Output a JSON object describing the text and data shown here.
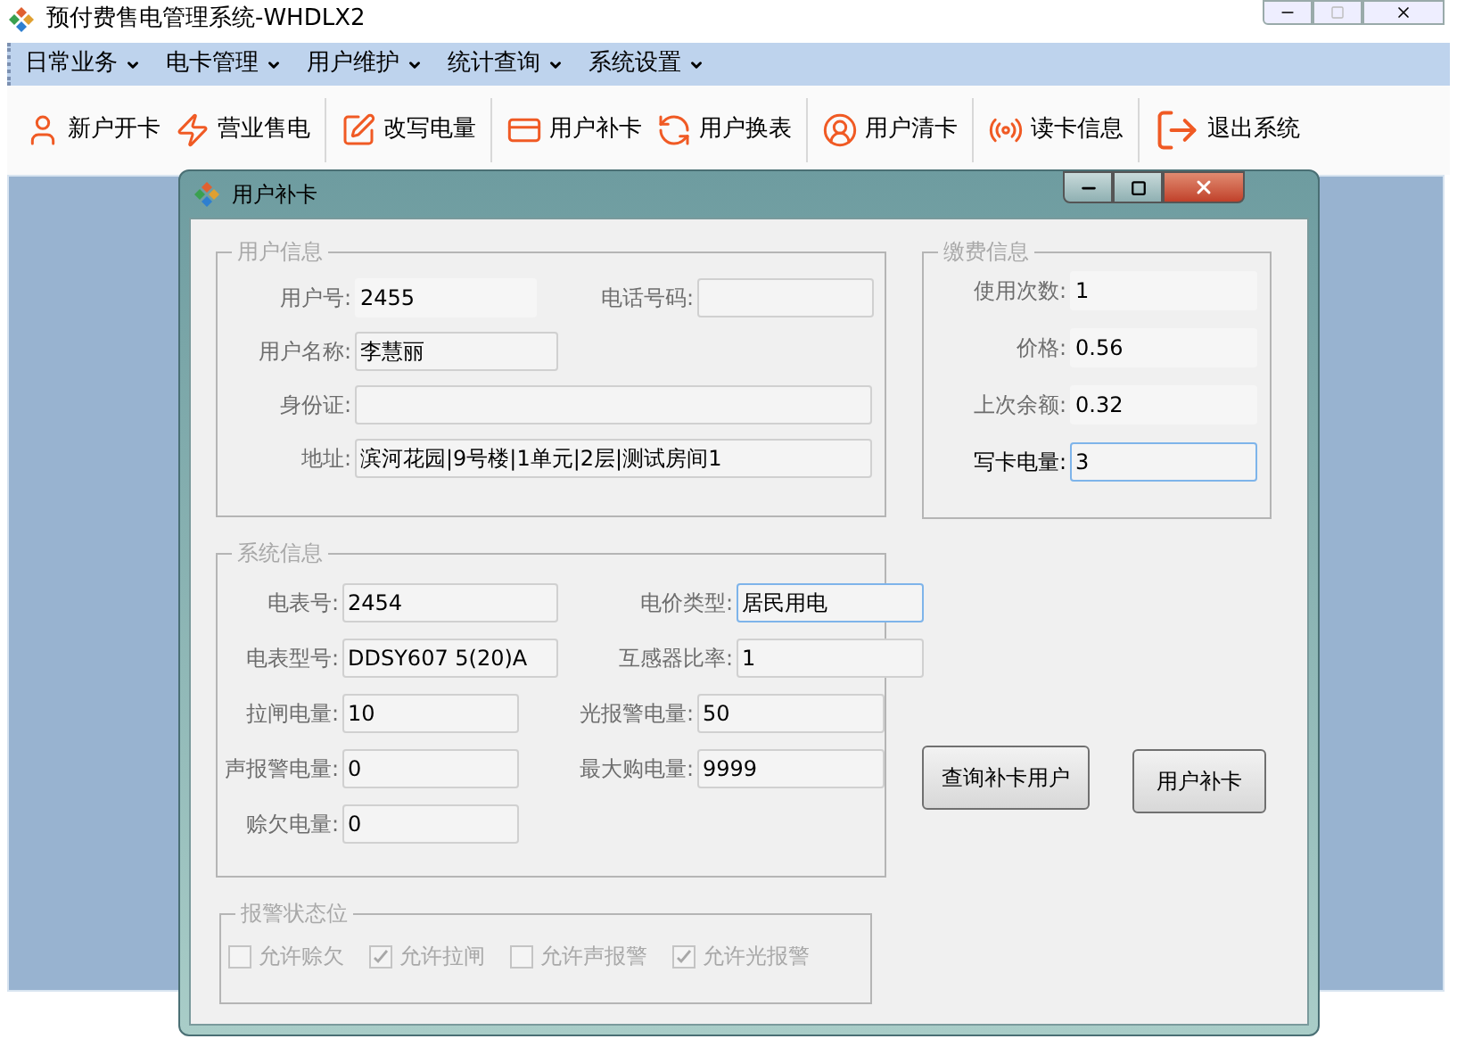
{
  "window": {
    "title": "预付费售电管理系统-WHDLX2"
  },
  "menu": [
    {
      "label": "日常业务"
    },
    {
      "label": "电卡管理"
    },
    {
      "label": "用户维护"
    },
    {
      "label": "统计查询"
    },
    {
      "label": "系统设置"
    }
  ],
  "toolbar": [
    [
      {
        "label": "新户开卡"
      },
      {
        "label": "营业售电"
      }
    ],
    [
      {
        "label": "改写电量"
      }
    ],
    [
      {
        "label": "用户补卡"
      },
      {
        "label": "用户换表"
      }
    ],
    [
      {
        "label": "用户清卡"
      }
    ],
    [
      {
        "label": "读卡信息"
      }
    ],
    [
      {
        "label": "退出系统"
      }
    ]
  ],
  "dialog": {
    "title": "用户补卡",
    "user_info": {
      "title": "用户信息",
      "fields": [
        {
          "label": "用户号:",
          "value": "2455",
          "kind": "flat",
          "disabled": true
        },
        {
          "label": "电话号码:",
          "kind": "box",
          "disabled": true
        },
        {
          "label": "用户名称:",
          "value": "李慧丽",
          "kind": "box",
          "disabled": true
        },
        {
          "label": "身份证:",
          "kind": "box",
          "disabled": true
        },
        {
          "label": "地址:",
          "value": "滨河花园|9号楼|1单元|2层|测试房间1",
          "kind": "box",
          "disabled": true
        }
      ]
    },
    "payment_info": {
      "title": "缴费信息",
      "fields": [
        {
          "label": "使用次数:",
          "value": "1",
          "kind": "flat",
          "disabled": true
        },
        {
          "label": "价格:",
          "value": "0.56",
          "kind": "flat",
          "disabled": true
        },
        {
          "label": "上次余额:",
          "value": "0.32",
          "kind": "flat",
          "disabled": true
        },
        {
          "label": "写卡电量:",
          "value": "3",
          "kind": "focus",
          "disabled": false
        }
      ]
    },
    "system_info": {
      "title": "系统信息",
      "fields": [
        {
          "label": "电表号:",
          "value": "2454",
          "kind": "box",
          "disabled": true
        },
        {
          "label": "电价类型:",
          "value": "居民用电",
          "kind": "focus",
          "disabled": true
        },
        {
          "label": "电表型号:",
          "value": "DDSY607 5(20)A",
          "kind": "box",
          "disabled": true
        },
        {
          "label": "互感器比率:",
          "value": "1",
          "kind": "box",
          "disabled": true
        },
        {
          "label": "拉闸电量:",
          "value": "10",
          "kind": "box",
          "disabled": true
        },
        {
          "label": "光报警电量:",
          "value": "50",
          "kind": "box",
          "disabled": true
        },
        {
          "label": "声报警电量:",
          "value": "0",
          "kind": "box",
          "disabled": true
        },
        {
          "label": "最大购电量:",
          "value": "9999",
          "kind": "box",
          "disabled": true
        },
        {
          "label": "赊欠电量:",
          "value": "0",
          "kind": "box",
          "disabled": true
        }
      ]
    },
    "alarm_status": {
      "title": "报警状态位",
      "options": [
        {
          "label": "允许赊欠",
          "checked": false,
          "disabled": true
        },
        {
          "label": "允许拉闸",
          "checked": true,
          "disabled": true
        },
        {
          "label": "允许声报警",
          "checked": false,
          "disabled": true
        },
        {
          "label": "允许光报警",
          "checked": true,
          "disabled": true
        }
      ]
    },
    "buttons": [
      {
        "label": "查询补卡用户"
      },
      {
        "label": "用户补卡"
      }
    ]
  }
}
